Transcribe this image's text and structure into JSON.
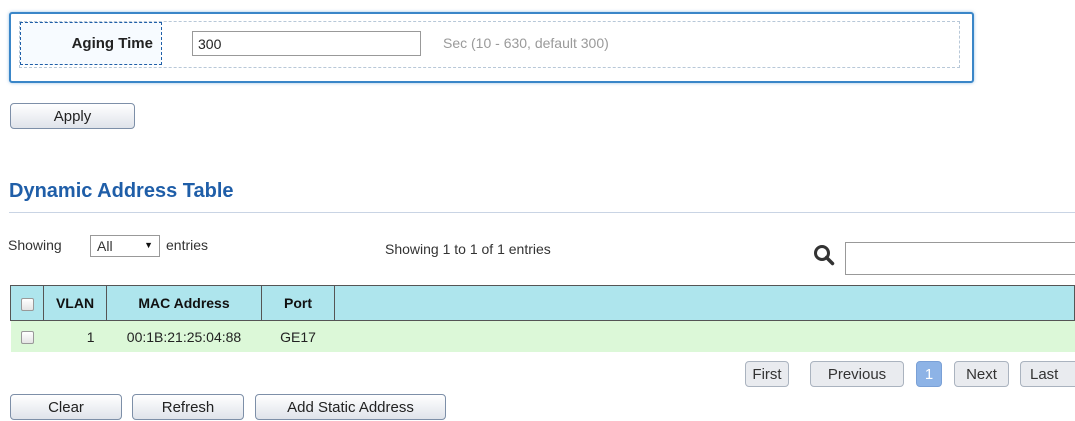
{
  "aging": {
    "label": "Aging Time",
    "value": "300",
    "hint": "Sec (10 - 630, default 300)"
  },
  "buttons": {
    "apply": "Apply",
    "clear": "Clear",
    "refresh": "Refresh",
    "add_static": "Add Static Address"
  },
  "section": {
    "title": "Dynamic Address Table"
  },
  "table_controls": {
    "showing_prefix": "Showing",
    "page_size": "All",
    "entries_suffix": "entries",
    "summary": "Showing 1 to 1 of 1 entries",
    "search_value": ""
  },
  "table": {
    "columns": [
      "VLAN",
      "MAC Address",
      "Port"
    ],
    "rows": [
      {
        "vlan": "1",
        "mac": "00:1B:21:25:04:88",
        "port": "GE17"
      }
    ]
  },
  "pagination": {
    "first": "First",
    "previous": "Previous",
    "current": "1",
    "next": "Next",
    "last": "Last"
  },
  "colors": {
    "accent": "#1f5ea8",
    "header_bg": "#aee5ed",
    "row_bg": "#dcf8d8"
  }
}
